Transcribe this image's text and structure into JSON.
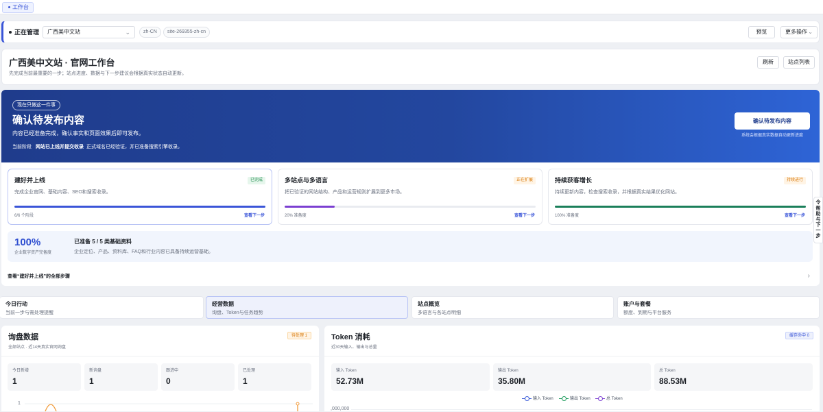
{
  "tabbar": {
    "active_tab": "工作台"
  },
  "manager": {
    "label": "正在管理",
    "site_select": "广西美中文站",
    "locale": "zh-CN",
    "site_id": "site-269355-zh-cn",
    "preview": "预览",
    "more": "更多操作"
  },
  "header": {
    "title": "广西美中文站 · 官网工作台",
    "subtitle": "先完成当前最重要的一步；站点进度、数据与下一步建议会根据真实状态自动更新。",
    "refresh": "刷新",
    "site_list": "站点列表"
  },
  "hero": {
    "pill": "现在只做这一件事",
    "title": "确认待发布内容",
    "desc": "内容已经准备完成，确认事实和页面效果后即可发布。",
    "stage_label": "当前阶段",
    "stage_name": "网站已上线并提交收录",
    "stage_note": "正式域名已经验证，并已准备搜索引擎收录。",
    "cta": "确认待发布内容",
    "cta_note": "系统会根据真实数据自动更新进度"
  },
  "stages": [
    {
      "title": "建好并上线",
      "desc": "完成企业官网、基础内容、SEO和搜索收录。",
      "badge": "已完成",
      "progress": 1.0,
      "foot": "6/6 个阶段",
      "next": "查看下一步",
      "color": "#3a55d8"
    },
    {
      "title": "多站点与多语言",
      "desc": "把已验证的网站结构、产品和运营规则扩展到更多市场。",
      "badge": "正在扩展",
      "progress": 0.2,
      "foot": "20% 准备度",
      "next": "查看下一步",
      "color": "#7b3fd1"
    },
    {
      "title": "持续获客增长",
      "desc": "持续更新内容，检查搜索收录，并根据真实结果优化网站。",
      "badge": "持续进行",
      "progress": 1.0,
      "foot": "100% 准备度",
      "next": "查看下一步",
      "color": "#1a7f5a"
    }
  ],
  "readiness": {
    "percent": "100%",
    "percent_label": "企业数字资产完备度",
    "title": "已准备 5 / 5 类基础资料",
    "desc": "企业定位、产品、资料库、FAQ和行业内容已具备持续运营基础。"
  },
  "all_steps": "查看“建好并上线”的全部步骤",
  "quick_tabs": [
    {
      "title": "今日行动",
      "desc": "当前一步与需处理提醒"
    },
    {
      "title": "经营数据",
      "desc": "询盘、Token与任务趋势"
    },
    {
      "title": "站点概览",
      "desc": "多语言与各站点明细"
    },
    {
      "title": "账户与套餐",
      "desc": "额度、到期与平台服务"
    }
  ],
  "inquiry": {
    "title": "询盘数据",
    "desc": "全部站点 · 近14天真实官网询盘",
    "tag": "待处理 1",
    "stats": [
      {
        "label": "今日新增",
        "value": "1"
      },
      {
        "label": "新询盘",
        "value": "1"
      },
      {
        "label": "跟进中",
        "value": "0"
      },
      {
        "label": "已处理",
        "value": "1"
      }
    ],
    "y_tick": "1"
  },
  "token": {
    "title": "Token 消耗",
    "desc": "近30天输入、输出与总量",
    "tag": "缓存命中 0",
    "stats": [
      {
        "label": "输入 Token",
        "value": "52.73M"
      },
      {
        "label": "输出 Token",
        "value": "35.80M"
      },
      {
        "label": "总 Token",
        "value": "88.53M"
      }
    ],
    "legend": [
      {
        "name": "输入 Token",
        "color": "#3a5bd8"
      },
      {
        "name": "输出 Token",
        "color": "#1a9a5a"
      },
      {
        "name": "总 Token",
        "color": "#7b3fd1"
      }
    ],
    "y_tick": ",000,000"
  },
  "side_helper": "帮助与下一步"
}
